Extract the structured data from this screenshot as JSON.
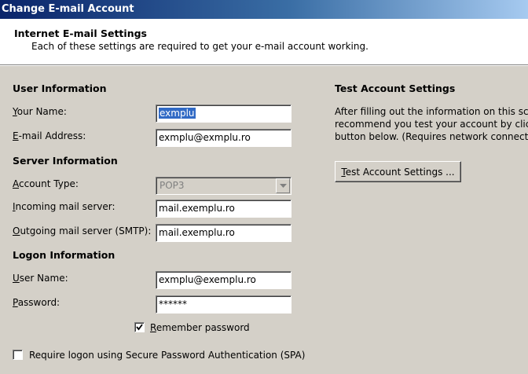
{
  "window": {
    "title": "Change E-mail Account"
  },
  "header": {
    "title": "Internet E-mail Settings",
    "subtitle": "Each of these settings are required to get your e-mail account working."
  },
  "user_info": {
    "heading": "User Information",
    "name_label_first": "Y",
    "name_label_rest": "our Name:",
    "name_value": "exmplu",
    "email_label_first": "E",
    "email_label_rest": "-mail Address:",
    "email_value": "exmplu@exmplu.ro"
  },
  "server_info": {
    "heading": "Server Information",
    "account_type_label_first": "A",
    "account_type_label_rest": "ccount Type:",
    "account_type_value": "POP3",
    "incoming_label_first": "I",
    "incoming_label_rest": "ncoming mail server:",
    "incoming_value": "mail.exemplu.ro",
    "outgoing_label_first": "O",
    "outgoing_label_rest": "utgoing mail server (SMTP):",
    "outgoing_value": "mail.exemplu.ro"
  },
  "logon_info": {
    "heading": "Logon Information",
    "username_label_first": "U",
    "username_label_rest": "ser Name:",
    "username_value": "exmplu@exemplu.ro",
    "password_label_first": "P",
    "password_label_rest": "assword:",
    "password_value": "******",
    "remember_label_first": "R",
    "remember_label_rest": "emember password",
    "remember_checked": true,
    "spa_label": "Require logon using Secure Password Authentication (SPA)",
    "spa_checked": false
  },
  "test": {
    "heading": "Test Account Settings",
    "desc_line1": "After filling out the information on this scre",
    "desc_line2": "recommend you test your account by clickin",
    "desc_line3": "button below. (Requires network connectio",
    "button_first": "T",
    "button_rest": "est Account Settings ..."
  },
  "colors": {
    "titlebar_start": "#0a246a",
    "dialog_bg": "#d4d0c8",
    "selection": "#316ac5"
  }
}
